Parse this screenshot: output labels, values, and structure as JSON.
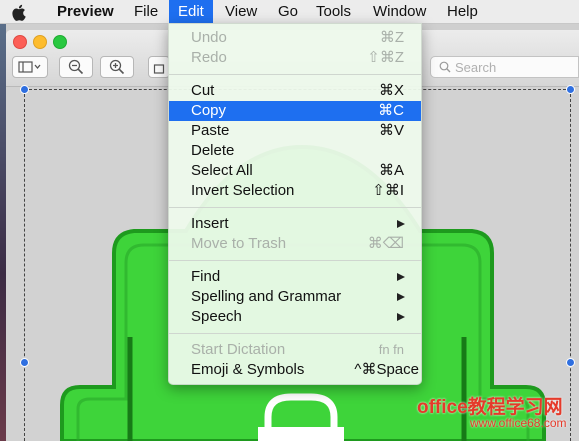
{
  "colors": {
    "accent": "#1e6ff0",
    "robot_green": "#3ed43a",
    "robot_outline": "#1e9a1e"
  },
  "menubar": {
    "apple_icon": "apple-icon",
    "app_name": "Preview",
    "items": [
      "File",
      "Edit",
      "View",
      "Go",
      "Tools",
      "Window",
      "Help"
    ],
    "active": "Edit"
  },
  "toolbar": {
    "buttons": [
      "sidebar-toggle-icon",
      "zoom-out-icon",
      "zoom-in-icon",
      "share-icon"
    ],
    "search_placeholder": "Search"
  },
  "edit_menu": {
    "undo": {
      "label": "Undo",
      "shortcut": "⌘Z"
    },
    "redo": {
      "label": "Redo",
      "shortcut": "⇧⌘Z"
    },
    "cut": {
      "label": "Cut",
      "shortcut": "⌘X"
    },
    "copy": {
      "label": "Copy",
      "shortcut": "⌘C"
    },
    "paste": {
      "label": "Paste",
      "shortcut": "⌘V"
    },
    "delete": {
      "label": "Delete"
    },
    "select_all": {
      "label": "Select All",
      "shortcut": "⌘A"
    },
    "invert_selection": {
      "label": "Invert Selection",
      "shortcut": "⇧⌘I"
    },
    "insert": {
      "label": "Insert"
    },
    "move_to_trash": {
      "label": "Move to Trash",
      "shortcut": "⌘⌫"
    },
    "find": {
      "label": "Find"
    },
    "spelling": {
      "label": "Spelling and Grammar"
    },
    "speech": {
      "label": "Speech"
    },
    "start_dictation": {
      "label": "Start Dictation",
      "shortcut": "fn fn"
    },
    "emoji": {
      "label": "Emoji & Symbols",
      "shortcut": "^⌘Space"
    }
  },
  "watermark": {
    "line1": "office教程学习网",
    "line2": "www.office68.com"
  }
}
